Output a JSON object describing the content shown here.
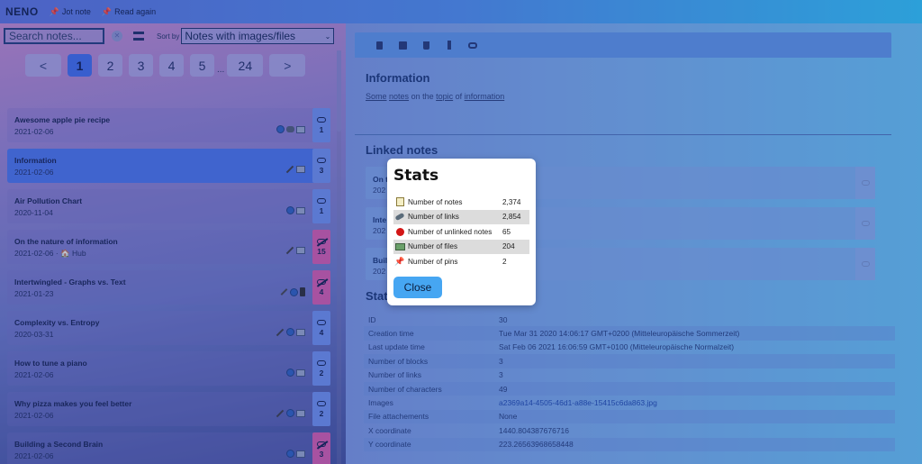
{
  "header": {
    "logo": "NENO",
    "jot_note": "Jot note",
    "read_again": "Read again",
    "right_items": [
      "",
      ""
    ]
  },
  "left": {
    "search_placeholder": "Search notes...",
    "sort_label": "Sort by",
    "sort_value": "Notes with images/files",
    "pagination": {
      "prev": "<",
      "next": ">",
      "pages": [
        "1",
        "2",
        "3",
        "4",
        "5"
      ],
      "ellipsis": "...",
      "last": "24",
      "current": "1"
    },
    "notes": [
      {
        "title": "Awesome apple pie recipe",
        "date": "2021-02-06",
        "links": "1",
        "unlinked": false,
        "active": false,
        "icons": [
          "globe-icon",
          "mask-icon",
          "image-icon"
        ]
      },
      {
        "title": "Information",
        "date": "2021-02-06",
        "links": "3",
        "unlinked": false,
        "active": true,
        "icons": [
          "pencil-icon",
          "image-icon"
        ]
      },
      {
        "title": "Air Pollution Chart",
        "date": "2020-11-04",
        "links": "1",
        "unlinked": false,
        "active": false,
        "icons": [
          "globe-icon",
          "image-icon"
        ]
      },
      {
        "title": "On the nature of information",
        "date": "2021-02-06 · 🏠 Hub",
        "links": "15",
        "unlinked": true,
        "active": false,
        "icons": [
          "pencil-icon",
          "image-icon"
        ]
      },
      {
        "title": "Intertwingled - Graphs vs. Text",
        "date": "2021-01-23",
        "links": "4",
        "unlinked": true,
        "active": false,
        "icons": [
          "pen-icon",
          "globe-icon",
          "video-icon"
        ]
      },
      {
        "title": "Complexity vs. Entropy",
        "date": "2020-03-31",
        "links": "4",
        "unlinked": false,
        "active": false,
        "icons": [
          "pencil-icon",
          "globe-icon",
          "image-icon"
        ]
      },
      {
        "title": "How to tune a piano",
        "date": "2021-02-06",
        "links": "2",
        "unlinked": false,
        "active": false,
        "icons": [
          "globe-icon",
          "image-icon"
        ]
      },
      {
        "title": "Why pizza makes you feel better",
        "date": "2021-02-06",
        "links": "2",
        "unlinked": false,
        "active": false,
        "icons": [
          "pencil-icon",
          "globe-icon",
          "image-icon"
        ]
      },
      {
        "title": "Building a Second Brain",
        "date": "2021-02-06",
        "links": "3",
        "unlinked": true,
        "active": false,
        "icons": [
          "globe-icon",
          "image-icon"
        ]
      }
    ]
  },
  "editor": {
    "title": "Information",
    "description_words": [
      "Some",
      "notes",
      "on",
      "the",
      "topic",
      "of",
      "information"
    ],
    "linked_heading": "Linked notes",
    "linked": [
      {
        "title": "On t",
        "date": "202"
      },
      {
        "title": "Inte",
        "date": "202"
      },
      {
        "title": "Buil",
        "date": "202"
      }
    ],
    "stats_heading": "Stats",
    "stats": [
      {
        "key": "ID",
        "value": "30"
      },
      {
        "key": "Creation time",
        "value": "Tue Mar 31 2020 14:06:17 GMT+0200 (Mitteleuropäische Sommerzeit)"
      },
      {
        "key": "Last update time",
        "value": "Sat Feb 06 2021 16:06:59 GMT+0100 (Mitteleuropäische Normalzeit)"
      },
      {
        "key": "Number of blocks",
        "value": "3"
      },
      {
        "key": "Number of links",
        "value": "3"
      },
      {
        "key": "Number of characters",
        "value": "49"
      },
      {
        "key": "Images",
        "value": "a2369a14-4505-46d1-a88e-15415c6da863.jpg"
      },
      {
        "key": "File attachements",
        "value": "None"
      },
      {
        "key": "X coordinate",
        "value": "1440.804387676716"
      },
      {
        "key": "Y coordinate",
        "value": "223.26563968658448"
      }
    ]
  },
  "modal": {
    "title": "Stats",
    "rows": [
      {
        "icon": "memo-icon",
        "label": "Number of notes",
        "value": "2,374"
      },
      {
        "icon": "link-icon",
        "label": "Number of links",
        "value": "2,854"
      },
      {
        "icon": "red-circle-icon",
        "label": "Number of unlinked notes",
        "value": "65"
      },
      {
        "icon": "files-icon",
        "label": "Number of files",
        "value": "204"
      },
      {
        "icon": "pushpin-icon",
        "label": "Number of pins",
        "value": "2"
      }
    ],
    "close_label": "Close"
  }
}
